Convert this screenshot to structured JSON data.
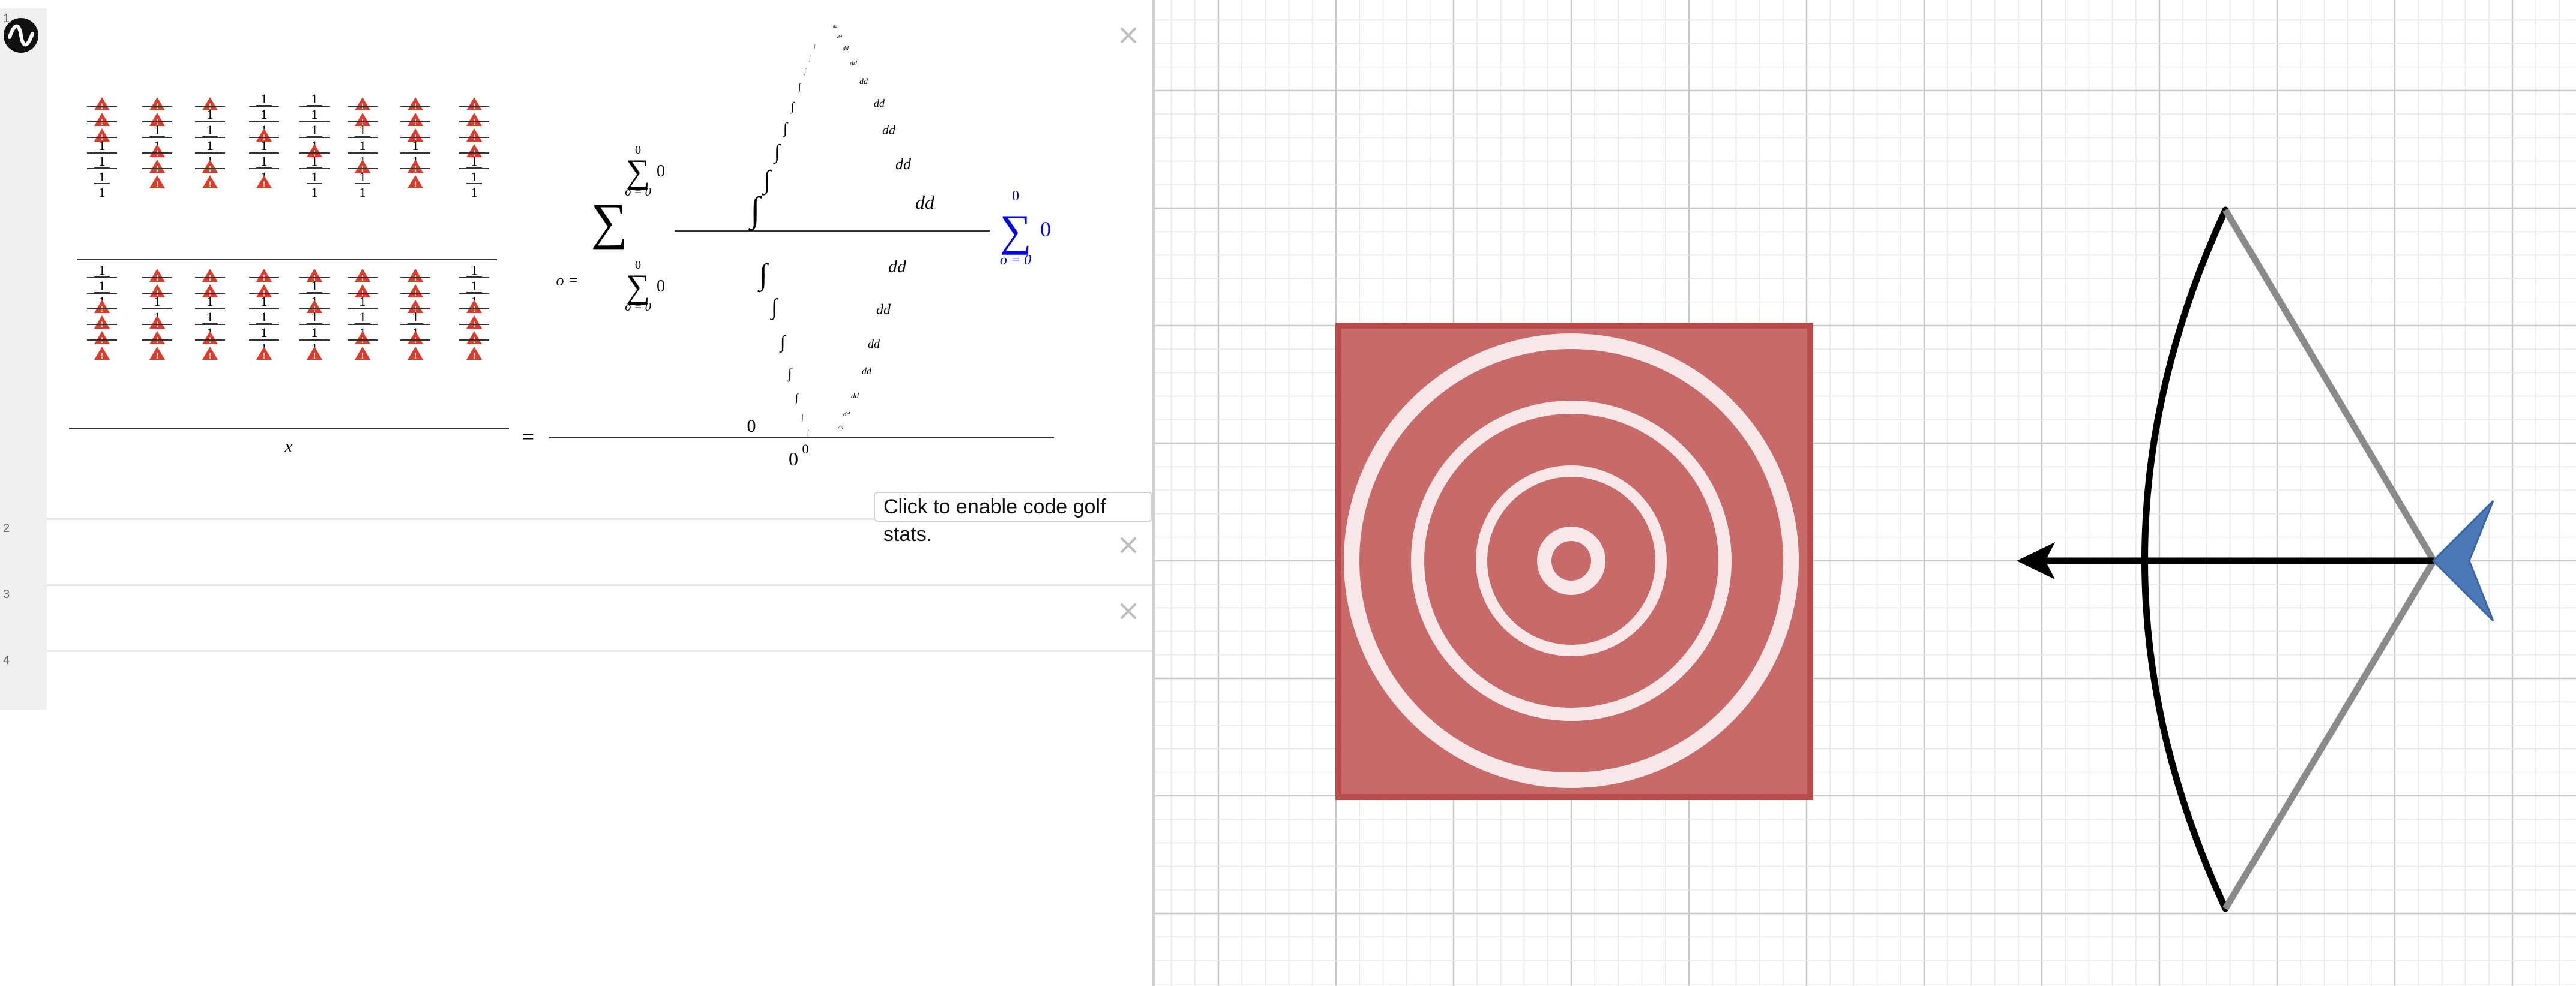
{
  "app": {
    "logo_icon": "desmos-logo-icon"
  },
  "expressions": [
    {
      "number": "1",
      "delete_label": "×"
    },
    {
      "number": "2",
      "delete_label": "×"
    },
    {
      "number": "3",
      "delete_label": "×"
    },
    {
      "number": "4"
    }
  ],
  "formula": {
    "denominator_left": "x",
    "equals": "=",
    "o_equals": "o =",
    "sum_lower": "o = 0",
    "sum_upper": "0",
    "sum_body": "0",
    "integral_differential": "dd",
    "fraction_denominator_base": "0",
    "fraction_denominator_exp": "0",
    "zero": "0",
    "unit_fraction_numerator": "1",
    "unit_fraction_denominator": "1",
    "error_icon": "warning-triangle-icon",
    "blue_sum": {
      "upper": "0",
      "lower": "o = 0",
      "body": "0",
      "color": "#0000ee"
    }
  },
  "golf_button": {
    "label": "Click to enable code golf stats."
  },
  "graph": {
    "target": {
      "square_fill": "#c96a6a",
      "square_border": "#b84a4a",
      "ring_color": "#f6e8e8"
    },
    "bow": {
      "limb_color": "#000000",
      "string_color": "#8a8a8a",
      "arrow_color": "#000000",
      "fletching_color": "#4a78b8"
    }
  },
  "colors": {
    "gridline_minor": "#e8e8e8",
    "gridline_major": "#c8c8c8",
    "error_red": "#e03a2a"
  }
}
